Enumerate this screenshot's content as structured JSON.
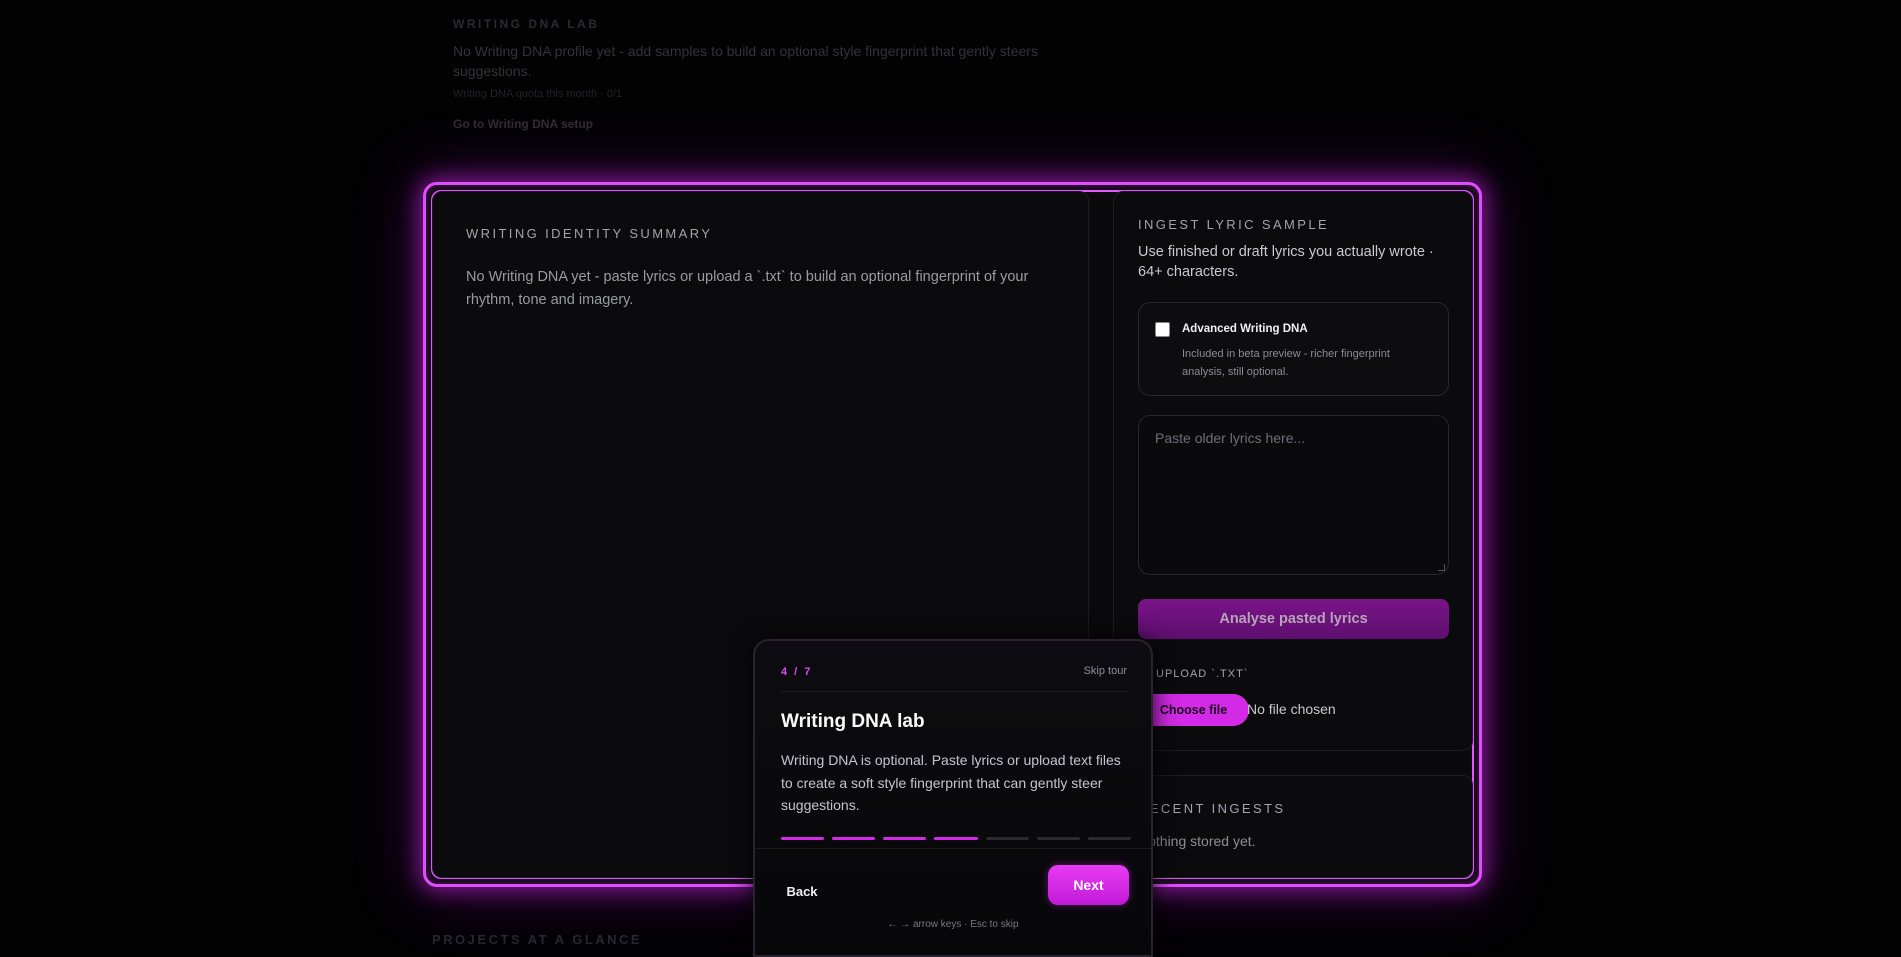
{
  "background": {
    "lab_eyebrow": "WRITING DNA LAB",
    "lab_message": "No Writing DNA profile yet - add samples to build an optional style fingerprint that gently steers suggestions.",
    "quota": "Writing DNA quota this month · 0/1",
    "setup_link": "Go to Writing DNA setup",
    "projects_heading": "PROJECTS AT A GLANCE"
  },
  "summary": {
    "eyebrow": "WRITING IDENTITY SUMMARY",
    "text": "No Writing DNA yet - paste lyrics or upload a `.txt` to build an optional fingerprint of your rhythm, tone and imagery."
  },
  "ingest": {
    "eyebrow": "INGEST LYRIC SAMPLE",
    "description": "Use finished or draft lyrics you actually wrote · 64+ characters.",
    "advanced": {
      "title": "Advanced Writing DNA",
      "note": "Included in beta preview - richer fingerprint analysis, still optional.",
      "checked": false
    },
    "textarea_placeholder": "Paste older lyrics here...",
    "analyse_button": "Analyse pasted lyrics",
    "upload_label": "UPLOAD `.TXT`",
    "choose_file": "Choose file",
    "no_file": "No file chosen"
  },
  "recent": {
    "eyebrow": "RECENT INGESTS",
    "text": "Nothing stored yet."
  },
  "tour": {
    "step": "4 / 7",
    "skip": "Skip tour",
    "title": "Writing DNA lab",
    "body": "Writing DNA is optional. Paste lyrics or upload text files to create a soft style fingerprint that can gently steer suggestions.",
    "progress_current": 4,
    "progress_total": 7,
    "back": "Back",
    "next": "Next",
    "hint": "← → arrow keys · Esc to skip"
  },
  "colors": {
    "accent": "#d22ae6",
    "glow": "#e04dff",
    "background": "#020203"
  }
}
